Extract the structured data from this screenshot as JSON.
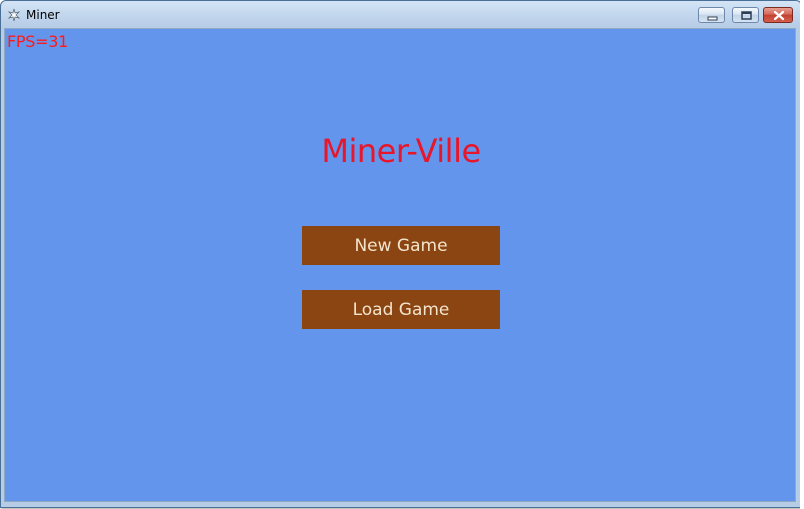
{
  "window": {
    "title": "Miner"
  },
  "colors": {
    "client_background": "#6495ed",
    "fps_text": "#ff1a1a",
    "title_text": "#e8162a",
    "button_background": "#8b4513",
    "button_text": "#f4e4cc"
  },
  "hud": {
    "fps": "FPS=31"
  },
  "menu": {
    "title": "Miner-Ville",
    "buttons": [
      {
        "label": "New Game"
      },
      {
        "label": "Load Game"
      }
    ]
  },
  "icons": {
    "app": "app-icon",
    "minimize": "minimize-icon",
    "maximize": "maximize-icon",
    "close": "close-icon"
  }
}
